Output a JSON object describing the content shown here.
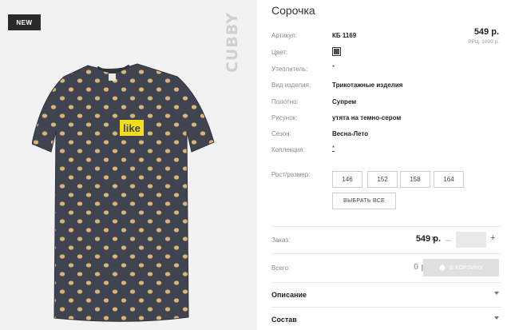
{
  "badge": "NEW",
  "brand": "CUBBY",
  "shirt_print": "like",
  "product": {
    "title": "Сорочка",
    "price": "549 р.",
    "rrp": "РРЦ: 1099 р."
  },
  "attributes": [
    {
      "label": "Артикул:",
      "value": "КБ 1169"
    },
    {
      "label": "Цвет:",
      "value": ""
    },
    {
      "label": "Утеплитель:",
      "value": "*"
    },
    {
      "label": "Вид изделия:",
      "value": "Трикотажные изделия"
    },
    {
      "label": "Полотно:",
      "value": "Супрем"
    },
    {
      "label": "Рисунок:",
      "value": "утята на темно-сером"
    },
    {
      "label": "Сезон:",
      "value": "Весна-Лето"
    },
    {
      "label": "Коллекция:",
      "value": "*"
    }
  ],
  "colors": {
    "swatch": "#4d4d4d",
    "shirt": "#3f4450",
    "dots": "#d8b476",
    "print_bg": "#f5dc1c"
  },
  "sizes": {
    "label": "Рост/размер:",
    "options": [
      "146",
      "152",
      "158",
      "164"
    ],
    "select_all": "ВЫБРАТЬ ВСЕ"
  },
  "order": {
    "label": "Заказ:",
    "price": "549 р.",
    "times": "×",
    "minus": "–",
    "plus": "+",
    "quantity": ""
  },
  "total": {
    "label": "Всего:",
    "value": "0 р.",
    "cart_button": "В КОРЗИНУ"
  },
  "accordions": [
    {
      "title": "Описание"
    },
    {
      "title": "Состав"
    }
  ]
}
